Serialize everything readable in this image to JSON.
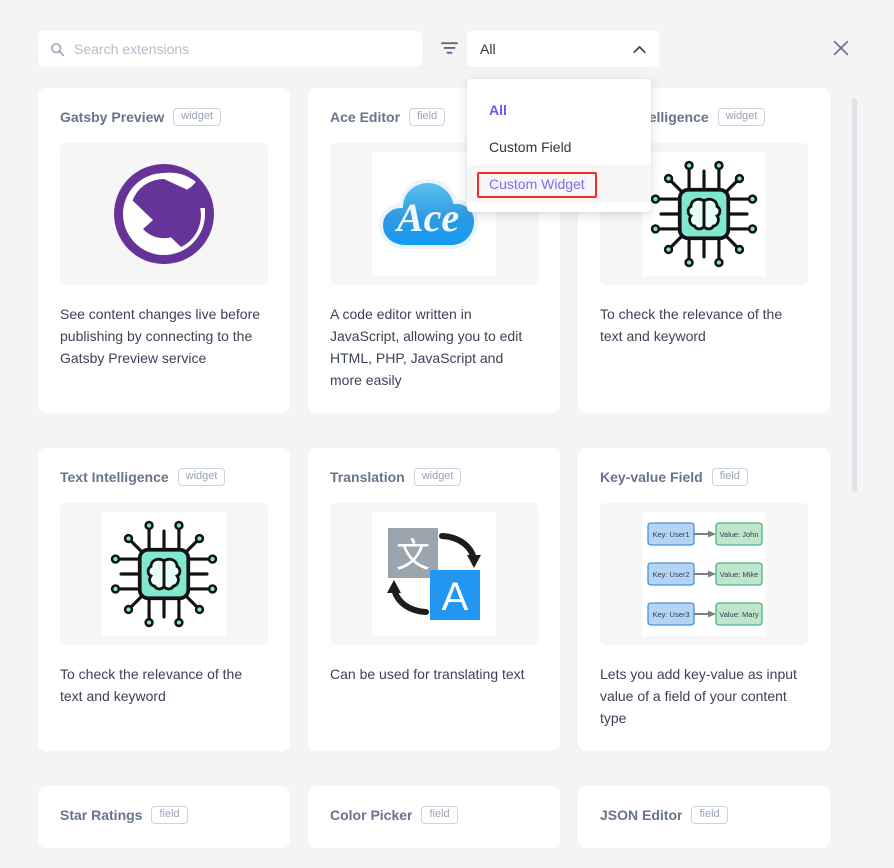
{
  "search": {
    "placeholder": "Search extensions",
    "value": "",
    "icon": "search-icon"
  },
  "filter": {
    "icon": "filter-icon",
    "selected": "All",
    "chevron": "chevron-up-icon",
    "expanded": true,
    "options": [
      {
        "label": "All",
        "state": "selected"
      },
      {
        "label": "Custom Field",
        "state": "normal"
      },
      {
        "label": "Custom Widget",
        "state": "highlighted"
      }
    ]
  },
  "close": {
    "icon": "close-icon",
    "label": "Close"
  },
  "colors": {
    "accent": "#6558f5",
    "accent_light": "#7a6ff0",
    "highlight_box": "#f42c2c",
    "background": "#f4f4f5",
    "card": "#ffffff",
    "title": "#67748e",
    "body_text": "#3c4257",
    "badge_text": "#9aa3b5",
    "gatsby_purple": "#663399",
    "ace_blue": "#38a7ec",
    "chip_teal": "#41d6b6",
    "translate_blue": "#2196f3",
    "keyvalue_blue": "#a9d0f5",
    "keyvalue_green": "#b7e5c8"
  },
  "extensions": [
    {
      "title": "Gatsby Preview",
      "badge": "widget",
      "description": "See content changes live before publishing by connecting to the Gatsby Preview service",
      "icon": "gatsby-logo-icon"
    },
    {
      "title": "Ace Editor",
      "badge": "field",
      "description": "A code editor written in JavaScript, allowing you to edit HTML, PHP, JavaScript and more easily",
      "icon": "ace-cloud-icon"
    },
    {
      "title": "Text Intelligence",
      "badge": "widget",
      "description": "To check the relevance of the text and keyword",
      "icon": "ai-chip-brain-icon"
    },
    {
      "title": "Text Intelligence",
      "badge": "widget",
      "description": "To check the relevance of the text and keyword",
      "icon": "ai-chip-brain-icon"
    },
    {
      "title": "Translation",
      "badge": "widget",
      "description": "Can be used for translating text",
      "icon": "translate-icon"
    },
    {
      "title": "Key-value Field",
      "badge": "field",
      "description": "Lets you add key-value as input value of a field of your content type",
      "icon": "key-value-diagram-icon"
    },
    {
      "title": "Star Ratings",
      "badge": "field",
      "description": "",
      "icon": "star-ratings-icon"
    },
    {
      "title": "Color Picker",
      "badge": "field",
      "description": "",
      "icon": "color-picker-icon"
    },
    {
      "title": "JSON Editor",
      "badge": "field",
      "description": "",
      "icon": "json-editor-icon"
    }
  ],
  "key_value_icon": {
    "keys": [
      "Key: User1",
      "Key: User2",
      "Key: User3"
    ],
    "values": [
      "Value: John",
      "Value: Mike",
      "Value: Mary"
    ]
  },
  "translate_icon": {
    "source_glyph": "文",
    "target_glyph": "A"
  },
  "ace_icon": {
    "wordmark": "Ace"
  },
  "gatsby_icon": {
    "wordmark": "G"
  }
}
